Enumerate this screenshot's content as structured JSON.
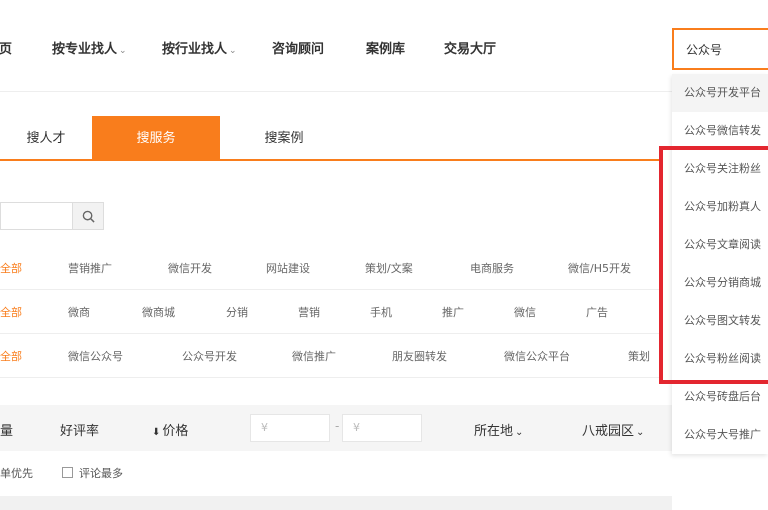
{
  "nav": {
    "items": [
      "首页",
      "按专业找人",
      "按行业找人",
      "咨询顾问",
      "案例库",
      "交易大厅"
    ],
    "caret": "⌄"
  },
  "search": {
    "value": "公众号"
  },
  "tabs": [
    "搜人才",
    "搜服务",
    "搜案例"
  ],
  "category_rows": [
    [
      "全部",
      "营销推广",
      "微信开发",
      "网站建设",
      "策划/文案",
      "电商服务",
      "微信/H5开发"
    ],
    [
      "全部",
      "微商",
      "微商城",
      "分销",
      "营销",
      "手机",
      "推广",
      "微信",
      "广告"
    ],
    [
      "全部",
      "微信公众号",
      "公众号开发",
      "微信推广",
      "朋友圈转发",
      "微信公众平台",
      "策划"
    ]
  ],
  "sortbar": {
    "sales": "量",
    "rating": "好评率",
    "price": "价格",
    "price_arrow": "⬇",
    "price_min_placeholder": "¥",
    "price_max_placeholder": "¥",
    "dash": "-",
    "location": "所在地",
    "park": "八戒园区"
  },
  "options": {
    "first": "单优先",
    "second": "评论最多"
  },
  "dropdown": {
    "items": [
      "公众号开发平台",
      "公众号微信转发",
      "公众号关注粉丝",
      "公众号加粉真人",
      "公众号文章阅读",
      "公众号分销商城",
      "公众号图文转发",
      "公众号粉丝阅读",
      "公众号砖盘后台",
      "公众号大号推广"
    ]
  },
  "colors": {
    "accent": "#f97d1c",
    "highlight": "#e3262f"
  }
}
